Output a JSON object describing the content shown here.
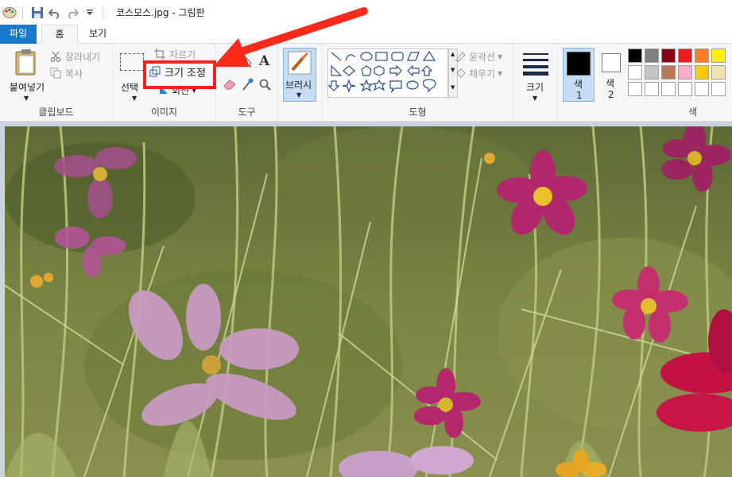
{
  "window": {
    "title": "코스모스.jpg - 그림판"
  },
  "tabs": [
    {
      "label": "파일"
    },
    {
      "label": "홈"
    },
    {
      "label": "보기"
    }
  ],
  "clipboard": {
    "paste": "붙여넣기",
    "cut": "잘라내기",
    "copy": "복사",
    "group": "클립보드"
  },
  "image": {
    "select": "선택",
    "crop": "자르기",
    "resize": "크기 조정",
    "rotate": "회전",
    "group": "이미지"
  },
  "tools": {
    "group": "도구"
  },
  "brush": {
    "label": "브러시"
  },
  "shapes": {
    "outline": "윤곽선",
    "fill": "채우기",
    "group": "도형"
  },
  "size": {
    "label": "크기"
  },
  "colors": {
    "color1_label": "색",
    "color1_num": "1",
    "color2_label": "색",
    "color2_num": "2",
    "group": "색",
    "palette_row1": [
      "#000000",
      "#7f7f7f",
      "#880015",
      "#ed1c24",
      "#ff7f27",
      "#fff200"
    ],
    "palette_row2": [
      "#ffffff",
      "#c3c3c3",
      "#b97a57",
      "#ffaec9",
      "#ffc90e",
      "#efe4b0"
    ],
    "palette_row3": [
      "#ffffff",
      "#ffffff",
      "#ffffff",
      "#ffffff",
      "#ffffff",
      "#ffffff"
    ]
  },
  "annotation": {
    "arrow_color": "#ff2a1a",
    "highlight": "resize-button"
  }
}
